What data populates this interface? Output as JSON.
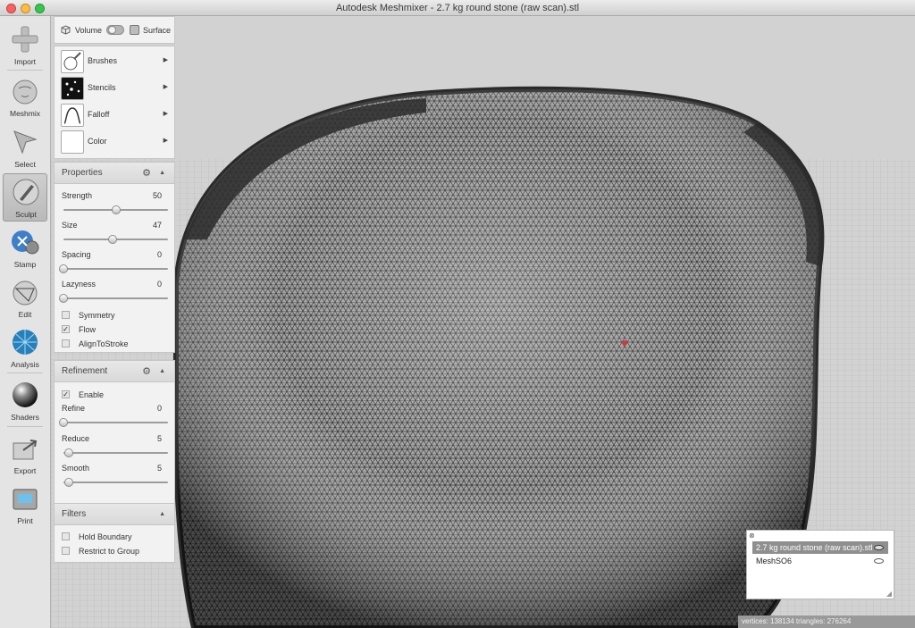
{
  "window": {
    "title": "Autodesk Meshmixer - 2.7 kg round stone (raw scan).stl"
  },
  "toolbar": {
    "items": [
      {
        "label": "Import",
        "icon": "plus-icon"
      },
      {
        "label": "Meshmix",
        "icon": "bunny-head-icon"
      },
      {
        "label": "Select",
        "icon": "arrow-cursor-icon"
      },
      {
        "label": "Sculpt",
        "icon": "brush-icon",
        "active": true
      },
      {
        "label": "Stamp",
        "icon": "stamp-icon"
      },
      {
        "label": "Edit",
        "icon": "edit-sphere-icon"
      },
      {
        "label": "Analysis",
        "icon": "analysis-sphere-icon"
      },
      {
        "label": "Shaders",
        "icon": "shader-sphere-icon"
      },
      {
        "label": "Export",
        "icon": "export-icon"
      },
      {
        "label": "Print",
        "icon": "printer-icon"
      }
    ]
  },
  "mode": {
    "volume_label": "Volume",
    "surface_label": "Surface"
  },
  "brush_menu": {
    "items": [
      {
        "label": "Brushes"
      },
      {
        "label": "Stencils"
      },
      {
        "label": "Falloff"
      },
      {
        "label": "Color"
      }
    ]
  },
  "properties": {
    "title": "Properties",
    "sliders": [
      {
        "label": "Strength",
        "value": "50",
        "position": 0.5
      },
      {
        "label": "Size",
        "value": "47",
        "position": 0.47
      },
      {
        "label": "Spacing",
        "value": "0",
        "position": 0
      },
      {
        "label": "Lazyness",
        "value": "0",
        "position": 0
      }
    ],
    "checks": [
      {
        "label": "Symmetry",
        "checked": false
      },
      {
        "label": "Flow",
        "checked": true
      },
      {
        "label": "AlignToStroke",
        "checked": false
      }
    ]
  },
  "refinement": {
    "title": "Refinement",
    "enable_label": "Enable",
    "enable_checked": true,
    "sliders": [
      {
        "label": "Refine",
        "value": "0",
        "position": 0
      },
      {
        "label": "Reduce",
        "value": "5",
        "position": 0.05
      },
      {
        "label": "Smooth",
        "value": "5",
        "position": 0.05
      }
    ]
  },
  "filters": {
    "title": "Filters",
    "checks": [
      {
        "label": "Hold Boundary",
        "checked": false
      },
      {
        "label": "Restrict to Group",
        "checked": false
      }
    ]
  },
  "objects": {
    "items": [
      {
        "label": "2.7 kg round stone (raw scan).stl",
        "selected": true
      },
      {
        "label": "MeshSO6",
        "selected": false
      }
    ]
  },
  "stats": {
    "text": "vertices: 138134 triangles: 276264"
  },
  "colors": {
    "accent": "#9a9a9a",
    "mesh_fill": "#9b9b9b",
    "mesh_edge": "#2e2e2e",
    "marker": "#d23a3a"
  }
}
